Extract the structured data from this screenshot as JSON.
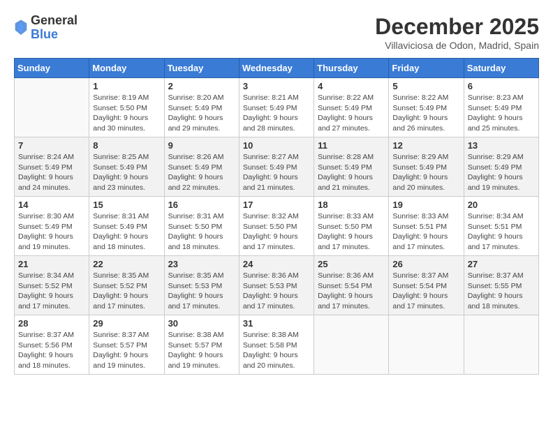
{
  "logo": {
    "general": "General",
    "blue": "Blue"
  },
  "title": "December 2025",
  "location": "Villaviciosa de Odon, Madrid, Spain",
  "days_of_week": [
    "Sunday",
    "Monday",
    "Tuesday",
    "Wednesday",
    "Thursday",
    "Friday",
    "Saturday"
  ],
  "weeks": [
    [
      {
        "day": "",
        "info": ""
      },
      {
        "day": "1",
        "info": "Sunrise: 8:19 AM\nSunset: 5:50 PM\nDaylight: 9 hours\nand 30 minutes."
      },
      {
        "day": "2",
        "info": "Sunrise: 8:20 AM\nSunset: 5:49 PM\nDaylight: 9 hours\nand 29 minutes."
      },
      {
        "day": "3",
        "info": "Sunrise: 8:21 AM\nSunset: 5:49 PM\nDaylight: 9 hours\nand 28 minutes."
      },
      {
        "day": "4",
        "info": "Sunrise: 8:22 AM\nSunset: 5:49 PM\nDaylight: 9 hours\nand 27 minutes."
      },
      {
        "day": "5",
        "info": "Sunrise: 8:22 AM\nSunset: 5:49 PM\nDaylight: 9 hours\nand 26 minutes."
      },
      {
        "day": "6",
        "info": "Sunrise: 8:23 AM\nSunset: 5:49 PM\nDaylight: 9 hours\nand 25 minutes."
      }
    ],
    [
      {
        "day": "7",
        "info": "Sunrise: 8:24 AM\nSunset: 5:49 PM\nDaylight: 9 hours\nand 24 minutes."
      },
      {
        "day": "8",
        "info": "Sunrise: 8:25 AM\nSunset: 5:49 PM\nDaylight: 9 hours\nand 23 minutes."
      },
      {
        "day": "9",
        "info": "Sunrise: 8:26 AM\nSunset: 5:49 PM\nDaylight: 9 hours\nand 22 minutes."
      },
      {
        "day": "10",
        "info": "Sunrise: 8:27 AM\nSunset: 5:49 PM\nDaylight: 9 hours\nand 21 minutes."
      },
      {
        "day": "11",
        "info": "Sunrise: 8:28 AM\nSunset: 5:49 PM\nDaylight: 9 hours\nand 21 minutes."
      },
      {
        "day": "12",
        "info": "Sunrise: 8:29 AM\nSunset: 5:49 PM\nDaylight: 9 hours\nand 20 minutes."
      },
      {
        "day": "13",
        "info": "Sunrise: 8:29 AM\nSunset: 5:49 PM\nDaylight: 9 hours\nand 19 minutes."
      }
    ],
    [
      {
        "day": "14",
        "info": "Sunrise: 8:30 AM\nSunset: 5:49 PM\nDaylight: 9 hours\nand 19 minutes."
      },
      {
        "day": "15",
        "info": "Sunrise: 8:31 AM\nSunset: 5:49 PM\nDaylight: 9 hours\nand 18 minutes."
      },
      {
        "day": "16",
        "info": "Sunrise: 8:31 AM\nSunset: 5:50 PM\nDaylight: 9 hours\nand 18 minutes."
      },
      {
        "day": "17",
        "info": "Sunrise: 8:32 AM\nSunset: 5:50 PM\nDaylight: 9 hours\nand 17 minutes."
      },
      {
        "day": "18",
        "info": "Sunrise: 8:33 AM\nSunset: 5:50 PM\nDaylight: 9 hours\nand 17 minutes."
      },
      {
        "day": "19",
        "info": "Sunrise: 8:33 AM\nSunset: 5:51 PM\nDaylight: 9 hours\nand 17 minutes."
      },
      {
        "day": "20",
        "info": "Sunrise: 8:34 AM\nSunset: 5:51 PM\nDaylight: 9 hours\nand 17 minutes."
      }
    ],
    [
      {
        "day": "21",
        "info": "Sunrise: 8:34 AM\nSunset: 5:52 PM\nDaylight: 9 hours\nand 17 minutes."
      },
      {
        "day": "22",
        "info": "Sunrise: 8:35 AM\nSunset: 5:52 PM\nDaylight: 9 hours\nand 17 minutes."
      },
      {
        "day": "23",
        "info": "Sunrise: 8:35 AM\nSunset: 5:53 PM\nDaylight: 9 hours\nand 17 minutes."
      },
      {
        "day": "24",
        "info": "Sunrise: 8:36 AM\nSunset: 5:53 PM\nDaylight: 9 hours\nand 17 minutes."
      },
      {
        "day": "25",
        "info": "Sunrise: 8:36 AM\nSunset: 5:54 PM\nDaylight: 9 hours\nand 17 minutes."
      },
      {
        "day": "26",
        "info": "Sunrise: 8:37 AM\nSunset: 5:54 PM\nDaylight: 9 hours\nand 17 minutes."
      },
      {
        "day": "27",
        "info": "Sunrise: 8:37 AM\nSunset: 5:55 PM\nDaylight: 9 hours\nand 18 minutes."
      }
    ],
    [
      {
        "day": "28",
        "info": "Sunrise: 8:37 AM\nSunset: 5:56 PM\nDaylight: 9 hours\nand 18 minutes."
      },
      {
        "day": "29",
        "info": "Sunrise: 8:37 AM\nSunset: 5:57 PM\nDaylight: 9 hours\nand 19 minutes."
      },
      {
        "day": "30",
        "info": "Sunrise: 8:38 AM\nSunset: 5:57 PM\nDaylight: 9 hours\nand 19 minutes."
      },
      {
        "day": "31",
        "info": "Sunrise: 8:38 AM\nSunset: 5:58 PM\nDaylight: 9 hours\nand 20 minutes."
      },
      {
        "day": "",
        "info": ""
      },
      {
        "day": "",
        "info": ""
      },
      {
        "day": "",
        "info": ""
      }
    ]
  ]
}
